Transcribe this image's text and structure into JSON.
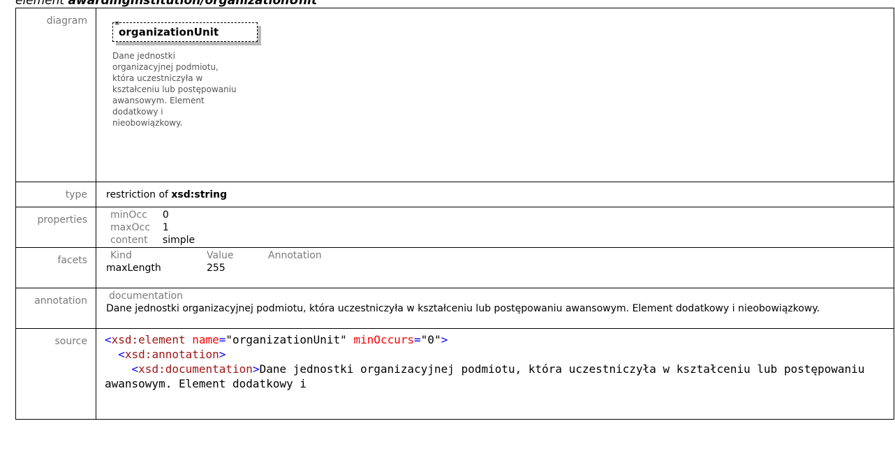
{
  "heading": {
    "prefix": "element",
    "path": "awardingInstitution/organizationUnit"
  },
  "labels": {
    "diagram": "diagram",
    "type": "type",
    "properties": "properties",
    "facets": "facets",
    "annotation": "annotation",
    "source": "source"
  },
  "diagram": {
    "element_name": "organizationUnit",
    "icon": "documentation-icon",
    "documentation": "Dane jednostki\norganizacyjnej podmiotu,\nktóra uczestniczyła w\nkształceniu lub postępowaniu\nawansowym. Element\ndodatkowy i\nnieobowiązkowy."
  },
  "type": {
    "prefix": "restriction of",
    "base": "xsd:string"
  },
  "properties": [
    {
      "key": "minOcc",
      "value": "0"
    },
    {
      "key": "maxOcc",
      "value": "1"
    },
    {
      "key": "content",
      "value": "simple"
    }
  ],
  "facets": {
    "headers": [
      "Kind",
      "Value",
      "Annotation"
    ],
    "rows": [
      {
        "kind": "maxLength",
        "value": "255",
        "annotation": ""
      }
    ]
  },
  "annotation": {
    "title": "documentation",
    "text": "Dane jednostki organizacyjnej podmiotu, która uczestniczyła w kształceniu lub postępowaniu awansowym. Element dodatkowy i nieobowiązkowy."
  },
  "source": {
    "open_tag": "xsd:element",
    "attr1_name": "name",
    "attr1_value": "\"organizationUnit\"",
    "attr2_name": "minOccurs",
    "attr2_value": "\"0\"",
    "annotation_tag": "xsd:annotation",
    "documentation_tag": "xsd:documentation",
    "documentation_text": "Dane jednostki organizacyjnej podmiotu, która uczestniczyła w kształceniu lub postępowaniu awansowym. Element dodatkowy i"
  }
}
